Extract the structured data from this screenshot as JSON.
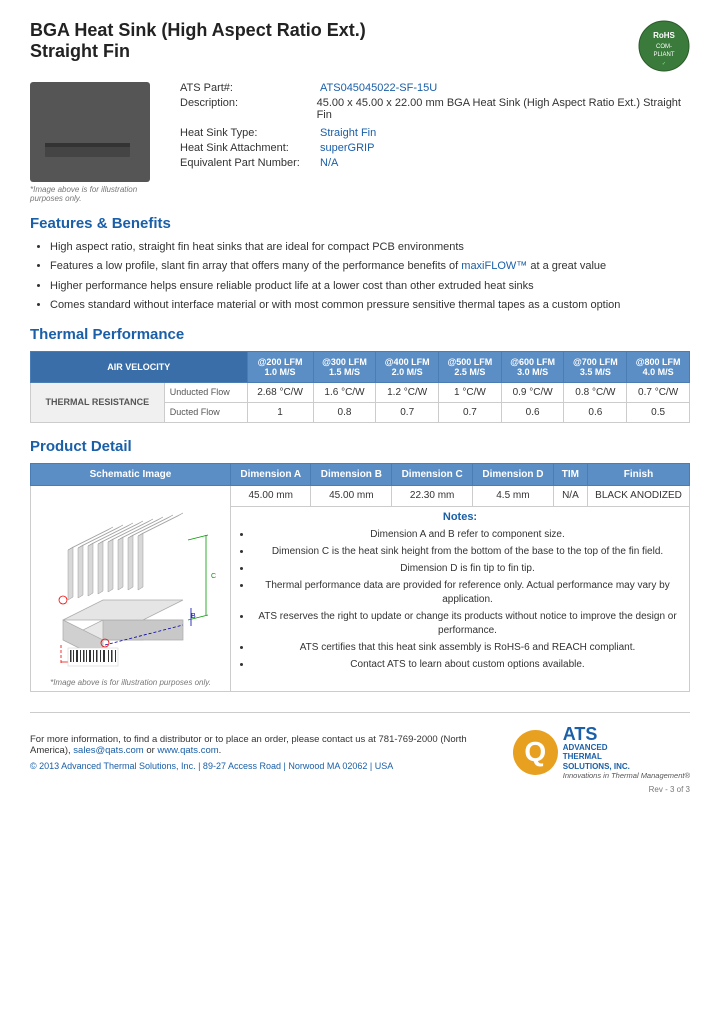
{
  "page": {
    "title_line1": "BGA Heat Sink (High Aspect Ratio Ext.)",
    "title_line2": "Straight Fin"
  },
  "product": {
    "part_label": "ATS Part#:",
    "part_number": "ATS045045022-SF-15U",
    "description_label": "Description:",
    "description": "45.00 x 45.00 x 22.00 mm  BGA Heat Sink (High Aspect Ratio Ext.) Straight Fin",
    "heat_sink_type_label": "Heat Sink Type:",
    "heat_sink_type": "Straight Fin",
    "heat_sink_attachment_label": "Heat Sink Attachment:",
    "heat_sink_attachment": "superGRIP",
    "equivalent_part_label": "Equivalent Part Number:",
    "equivalent_part": "N/A",
    "image_note": "*Image above is for illustration purposes only."
  },
  "features": {
    "section_title": "Features & Benefits",
    "items": [
      "High aspect ratio, straight fin heat sinks that are ideal for compact PCB environments",
      "Features a low profile, slant fin array that offers many of the performance benefits of maxiFLOW™ at a great value",
      "Higher performance helps ensure reliable product life at a lower cost than other extruded heat sinks",
      "Comes standard without interface material or with most common pressure sensitive thermal tapes as a custom option"
    ]
  },
  "thermal": {
    "section_title": "Thermal Performance",
    "col_header_row1": "AIR VELOCITY",
    "columns": [
      {
        "lfm": "@200 LFM",
        "ms": "1.0 M/S"
      },
      {
        "lfm": "@300 LFM",
        "ms": "1.5 M/S"
      },
      {
        "lfm": "@400 LFM",
        "ms": "2.0 M/S"
      },
      {
        "lfm": "@500 LFM",
        "ms": "2.5 M/S"
      },
      {
        "lfm": "@600 LFM",
        "ms": "3.0 M/S"
      },
      {
        "lfm": "@700 LFM",
        "ms": "3.5 M/S"
      },
      {
        "lfm": "@800 LFM",
        "ms": "4.0 M/S"
      }
    ],
    "row_label": "THERMAL RESISTANCE",
    "rows": [
      {
        "label": "Unducted Flow",
        "values": [
          "2.68 °C/W",
          "1.6 °C/W",
          "1.2 °C/W",
          "1 °C/W",
          "0.9 °C/W",
          "0.8 °C/W",
          "0.7 °C/W"
        ]
      },
      {
        "label": "Ducted Flow",
        "values": [
          "1",
          "0.8",
          "0.7",
          "0.7",
          "0.6",
          "0.6",
          "0.5"
        ]
      }
    ]
  },
  "product_detail": {
    "section_title": "Product Detail",
    "table_headers": [
      "Schematic Image",
      "Dimension A",
      "Dimension B",
      "Dimension C",
      "Dimension D",
      "TIM",
      "Finish"
    ],
    "dimensions": {
      "a": "45.00 mm",
      "b": "45.00 mm",
      "c": "22.30 mm",
      "d": "4.5 mm",
      "tim": "N/A",
      "finish": "BLACK ANODIZED"
    },
    "image_note": "*Image above is for illustration purposes only.",
    "notes_title": "Notes:",
    "notes": [
      "Dimension A and B refer to component size.",
      "Dimension C is the heat sink height from the bottom of the base to the top of the fin field.",
      "Dimension D is fin tip to fin tip.",
      "Thermal performance data are provided for reference only. Actual performance may vary by application.",
      "ATS reserves the right to update or change its products without notice to improve the design or performance.",
      "ATS certifies that this heat sink assembly is RoHS-6 and REACH compliant.",
      "Contact ATS to learn about custom options available."
    ]
  },
  "footer": {
    "info_text": "For more information, to find a distributor or to place an order, please contact us at 781-769-2000 (North America),",
    "email": "sales@qats.com",
    "or_text": "or",
    "website": "www.qats.com",
    "copyright": "© 2013 Advanced Thermal Solutions, Inc.",
    "address": "| 89-27 Access Road  |  Norwood MA   02062  |  USA",
    "page_num": "Rev - 3 of 3"
  }
}
